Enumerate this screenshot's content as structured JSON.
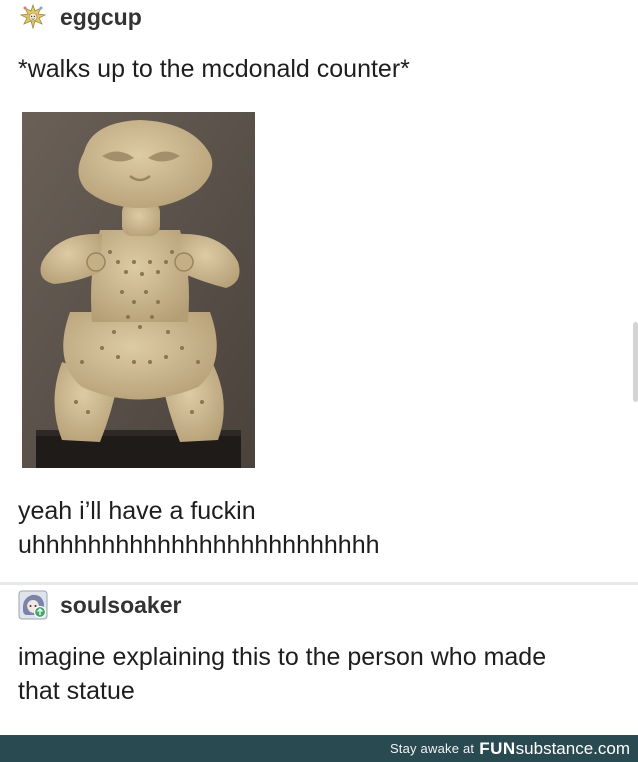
{
  "post1": {
    "username": "eggcup",
    "avatar_icon": "jester-avatar-icon",
    "line1": "*walks up to the mcdonald counter*",
    "image_icon": "clay-figurine-photo",
    "line2": "yeah i’ll have a fuckin",
    "line3": "uhhhhhhhhhhhhhhhhhhhhhhhhh"
  },
  "post2": {
    "username": "soulsoaker",
    "avatar_icon": "anime-avatar-icon",
    "line1": "imagine explaining this to the person who made",
    "line2": "that statue"
  },
  "watermark": {
    "prefix": "Stay awake at",
    "brand_bold": "FUN",
    "brand_rest": "substance",
    "brand_tld": ".com"
  },
  "colors": {
    "watermark_bg": "#2a4a52",
    "photo_bg": "#5b524a",
    "figurine": "#c9b68f"
  }
}
